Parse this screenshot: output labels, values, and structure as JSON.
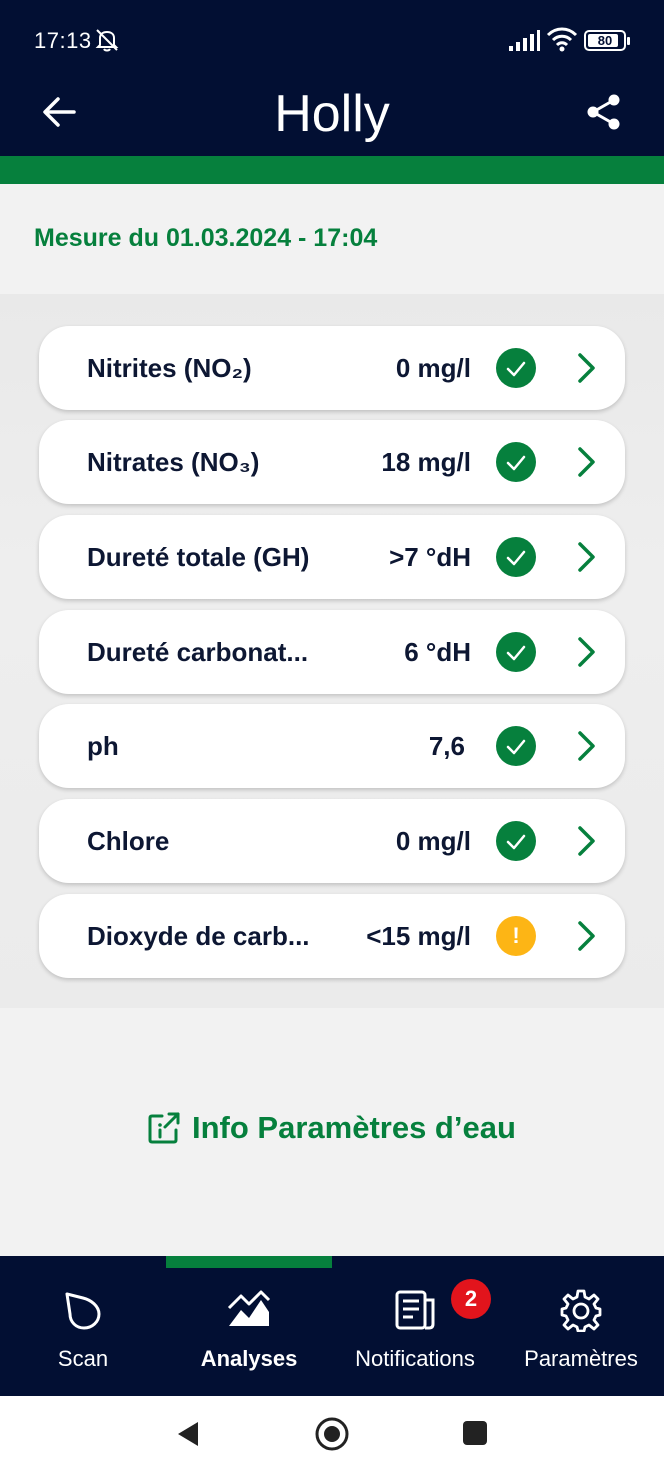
{
  "status_bar": {
    "time": "17:13",
    "battery": "80"
  },
  "header": {
    "title": "Holly",
    "back_icon": "arrow-left-icon",
    "share_icon": "share-icon"
  },
  "measurement": {
    "date_label": "Mesure du 01.03.2024 - 17:04"
  },
  "parameters": [
    {
      "name": "Nitrites (NO₂)",
      "value": "0 mg/l",
      "status": "ok"
    },
    {
      "name": "Nitrates (NO₃)",
      "value": "18 mg/l",
      "status": "ok"
    },
    {
      "name": "Dureté totale (GH)",
      "value": ">7 °dH",
      "status": "ok"
    },
    {
      "name": "Dureté carbonat...",
      "value": "6 °dH",
      "status": "ok"
    },
    {
      "name": "ph",
      "value": "7,6",
      "status": "ok"
    },
    {
      "name": "Chlore",
      "value": "0 mg/l",
      "status": "ok"
    },
    {
      "name": "Dioxyde de carb...",
      "value": "<15 mg/l",
      "status": "warning",
      "status_symbol": "!"
    }
  ],
  "info_link": {
    "label": "Info Paramètres d’eau"
  },
  "bottom_nav": {
    "items": [
      {
        "label": "Scan",
        "icon": "droplet-scan-icon",
        "active": false
      },
      {
        "label": "Analyses",
        "icon": "mountain-chart-icon",
        "active": true
      },
      {
        "label": "Notifications",
        "icon": "news-icon",
        "active": false,
        "badge": "2"
      },
      {
        "label": "Paramètres",
        "icon": "gear-icon",
        "active": false
      }
    ]
  },
  "colors": {
    "navy": "#020f33",
    "green": "#06803d",
    "warning": "#fdb515",
    "badge": "#e2141c"
  }
}
